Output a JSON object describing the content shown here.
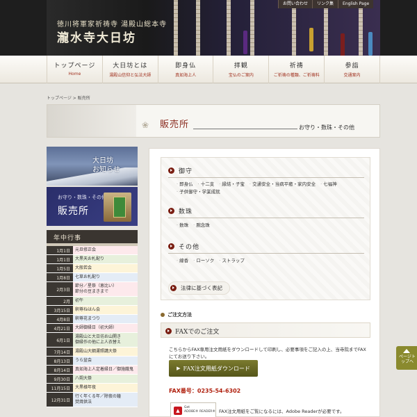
{
  "header": {
    "subtitle": "徳川将軍家祈祷寺 湯殿山総本寺",
    "title": "瀧水寺大日坊",
    "top_links": [
      "お問い合わせ",
      "リンク集",
      "English Page"
    ],
    "colors": {
      "bg": "#1e1e1e",
      "accent": "#a0301e"
    }
  },
  "nav": [
    {
      "label": "トップページ",
      "sub": "Home"
    },
    {
      "label": "大日坊とは",
      "sub": "湯殿山信仰と弘法大師"
    },
    {
      "label": "即身仏",
      "sub": "真如海上人"
    },
    {
      "label": "拝観",
      "sub": "宝仏のご案内"
    },
    {
      "label": "祈祷",
      "sub": "ご祈祷の種類、ご祈祷料"
    },
    {
      "label": "参詣",
      "sub": "交通案内"
    }
  ],
  "breadcrumb": "トップページ > 販売所",
  "banner": {
    "title": "販売所",
    "subtitle": "お守り・数珠・その他"
  },
  "sidebar": {
    "news_banner": "大日坊\nお知らせ",
    "shop_banner_small": "お守り・数珠・その他",
    "shop_banner": "販売所",
    "events_title": "年中行事",
    "events": [
      {
        "date": "1月1日",
        "text": "元旦修正会"
      },
      {
        "date": "1月1日",
        "text": "大黒天お札配り"
      },
      {
        "date": "1月5日",
        "text": "大般若会"
      },
      {
        "date": "1月8日",
        "text": "七草お札配り"
      },
      {
        "date": "2月3日",
        "text": "節分／星祭（恵比い）\n節分の豆まきまで"
      },
      {
        "date": "2月",
        "text": "初午"
      },
      {
        "date": "3月15日",
        "text": "釈尊ねはん会"
      },
      {
        "date": "4月8日",
        "text": "釈尊花まつり"
      },
      {
        "date": "4月21日",
        "text": "大師御縁日（初大師）"
      },
      {
        "date": "6月1日",
        "text": "湯殿山と大日坊お山開き\n御縁作の他に上人衣替え"
      },
      {
        "date": "7月14日",
        "text": "湯殿山大綱運照講大祭"
      },
      {
        "date": "8月13日",
        "text": "うら盆会"
      },
      {
        "date": "8月14日",
        "text": "真如海上人定着縁日／御施餓鬼"
      },
      {
        "date": "9月30日",
        "text": "八朔大祭"
      },
      {
        "date": "11月15日",
        "text": "大黒様年夜"
      },
      {
        "date": "12月31日",
        "text": "行く年くる年／除夜の鐘\n焚焼供法"
      }
    ]
  },
  "main": {
    "sections": [
      {
        "title": "御守",
        "items": [
          "即身仏",
          "十二支",
          "縁結・子宝",
          "交通安全・当病平癒・家内安全",
          "七福神",
          "子供御守・学業成就"
        ]
      },
      {
        "title": "数珠",
        "items": [
          "数珠",
          "腕念珠"
        ]
      },
      {
        "title": "その他",
        "items": [
          "線香",
          "ローソク",
          "ストラップ"
        ]
      }
    ],
    "law_link": "法律に基づく表記",
    "order_title": "ご注文方法",
    "fax_title": "FAXでのご注文",
    "fax_desc": "こちらからFAX専用注文用紙をダウンロードして印刷し、必要事項をご記入の上、当寺院までFAXにてお送り下さい。",
    "fax_button": "FAX注文用紙ダウンロード",
    "fax_number": "FAX番号：0235-54-6302",
    "reader_badge": "Get\nADOBE® READER®",
    "reader_note": "FAX注文用紙をご覧になるには、Adobe Readerが必要です。"
  },
  "pagetop": "ページトップへ"
}
